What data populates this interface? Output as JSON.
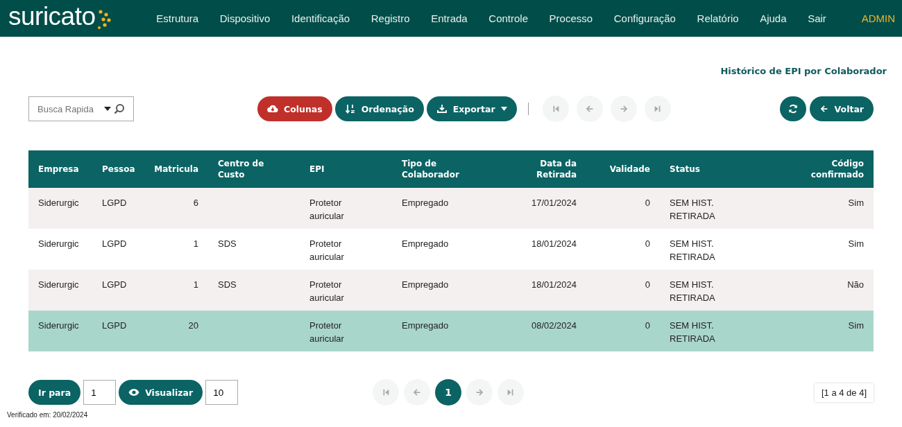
{
  "navbar": {
    "logo": "suricato",
    "menu": [
      "Estrutura",
      "Dispositivo",
      "Identificação",
      "Registro",
      "Entrada",
      "Controle",
      "Processo",
      "Configuração",
      "Relatório",
      "Ajuda",
      "Sair"
    ],
    "user": "ADMIN"
  },
  "page_title": "Histórico de EPI por Colaborador",
  "toolbar": {
    "search": {
      "placeholder": "Busca Rapida"
    },
    "buttons": [
      {
        "label": "Colunas",
        "kind": "danger",
        "dropdown": false
      },
      {
        "label": "Ordenação",
        "kind": "primary",
        "dropdown": false
      },
      {
        "label": "Exportar",
        "kind": "primary",
        "dropdown": true
      }
    ],
    "pager": [
      {
        "disabled": true
      },
      {
        "disabled": true
      },
      {
        "disabled": true
      },
      {
        "disabled": true
      }
    ],
    "back": "Voltar"
  },
  "table": {
    "columns": [
      "Empresa",
      "Pessoa",
      "Matricula",
      "Centro de Custo",
      "EPI",
      "Tipo de Colaborador",
      "Data da Retirada",
      "Validade",
      "Status",
      "Código confirmado"
    ],
    "rows": [
      {
        "selected": false,
        "cells": [
          "Siderurgic",
          "LGPD",
          "6",
          "",
          "Protetor auricular",
          "Empregado",
          "17/01/2024",
          "0",
          "SEM HIST. RETIRADA",
          "Sim"
        ]
      },
      {
        "selected": false,
        "cells": [
          "Siderurgic",
          "LGPD",
          "1",
          "SDS",
          "Protetor auricular",
          "Empregado",
          "18/01/2024",
          "0",
          "SEM HIST. RETIRADA",
          "Sim"
        ]
      },
      {
        "selected": false,
        "cells": [
          "Siderurgic",
          "LGPD",
          "1",
          "SDS",
          "Protetor auricular",
          "Empregado",
          "18/01/2024",
          "0",
          "SEM HIST. RETIRADA",
          "Não"
        ]
      },
      {
        "selected": true,
        "cells": [
          "Siderurgic",
          "LGPD",
          "20",
          "",
          "Protetor auricular",
          "Empregado",
          "08/02/2024",
          "0",
          "SEM HIST. RETIRADA",
          "Sim"
        ]
      }
    ]
  },
  "bottom": {
    "goto_label": "Ir para",
    "goto_value": "1",
    "view_label": "Visualizar",
    "view_value": "10",
    "pager": [
      {
        "kind": "nav",
        "disabled": true
      },
      {
        "kind": "nav",
        "disabled": true
      },
      {
        "kind": "page",
        "label": "1",
        "selected": true
      },
      {
        "kind": "nav",
        "disabled": true
      },
      {
        "kind": "nav",
        "disabled": true
      }
    ],
    "range": "[1 a 4 de 4]"
  },
  "footer": "Verificado em: 20/02/2024"
}
